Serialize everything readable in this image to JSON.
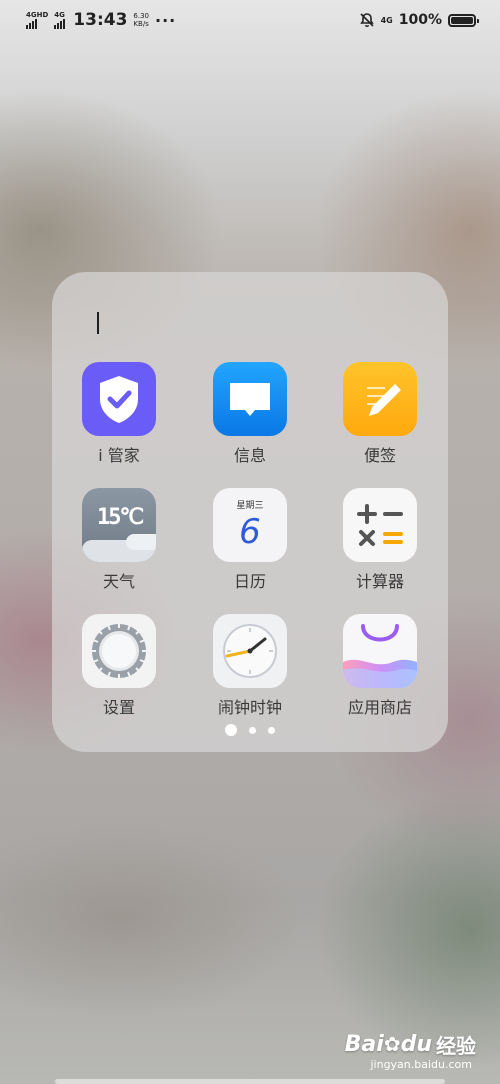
{
  "status_bar": {
    "network_1": "4GHD",
    "network_2": "4G",
    "time": "13:43",
    "speed_value": "6.30",
    "speed_unit": "KB/s",
    "more": "···",
    "network_3": "4G",
    "battery_pct": "100%",
    "battery_level": 1.0
  },
  "folder": {
    "name": "",
    "apps": [
      {
        "label": "i 管家",
        "icon": "shield-check-icon"
      },
      {
        "label": "信息",
        "icon": "message-icon"
      },
      {
        "label": "便签",
        "icon": "notes-pen-icon"
      },
      {
        "label": "天气",
        "icon": "weather-icon",
        "icon_text": "15℃"
      },
      {
        "label": "日历",
        "icon": "calendar-icon",
        "icon_weekday": "星期三",
        "icon_day": "6"
      },
      {
        "label": "计算器",
        "icon": "calculator-icon"
      },
      {
        "label": "设置",
        "icon": "gear-icon"
      },
      {
        "label": "闹钟时钟",
        "icon": "clock-icon"
      },
      {
        "label": "应用商店",
        "icon": "store-bag-icon"
      }
    ],
    "pages": 3,
    "active_page": 1
  },
  "watermark": {
    "brand": "Bai",
    "brand_suffix": "du",
    "product": "经验",
    "url": "jingyan.baidu.com"
  },
  "colors": {
    "i_manager": "#6c5cf5",
    "messages": "#1a8cf0",
    "notes": "#ffb51a",
    "clock_hand": "#f0b420"
  }
}
